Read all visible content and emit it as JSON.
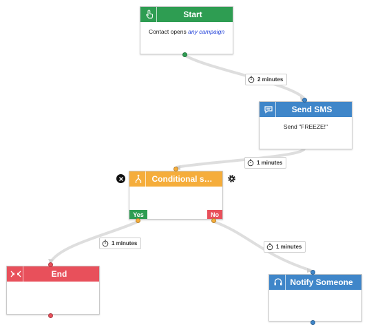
{
  "nodes": {
    "start": {
      "title": "Start",
      "body_prefix": "Contact opens",
      "body_link": "any campaign",
      "icon": "hand-pointer-icon",
      "color": "#2e9d52"
    },
    "send_sms": {
      "title": "Send SMS",
      "body": "Send \"FREEZE!\"",
      "icon": "chat-bubble-icon",
      "color": "#3f86c9"
    },
    "conditional": {
      "title": "Conditional s…",
      "icon": "branch-split-icon",
      "color": "#f5ad3b",
      "yes_label": "Yes",
      "no_label": "No"
    },
    "end": {
      "title": "End",
      "icon": "finish-flags-icon",
      "color": "#e8505b"
    },
    "notify": {
      "title": "Notify Someone",
      "icon": "headset-icon",
      "color": "#3f86c9"
    }
  },
  "delays": {
    "start_to_sms": "2 minutes",
    "sms_to_conditional": "1 minutes",
    "yes_to_end": "1 minutes",
    "no_to_notify": "1 minutes"
  },
  "controls": {
    "delete_icon": "close-circle-icon",
    "settings_icon": "gear-icon"
  }
}
